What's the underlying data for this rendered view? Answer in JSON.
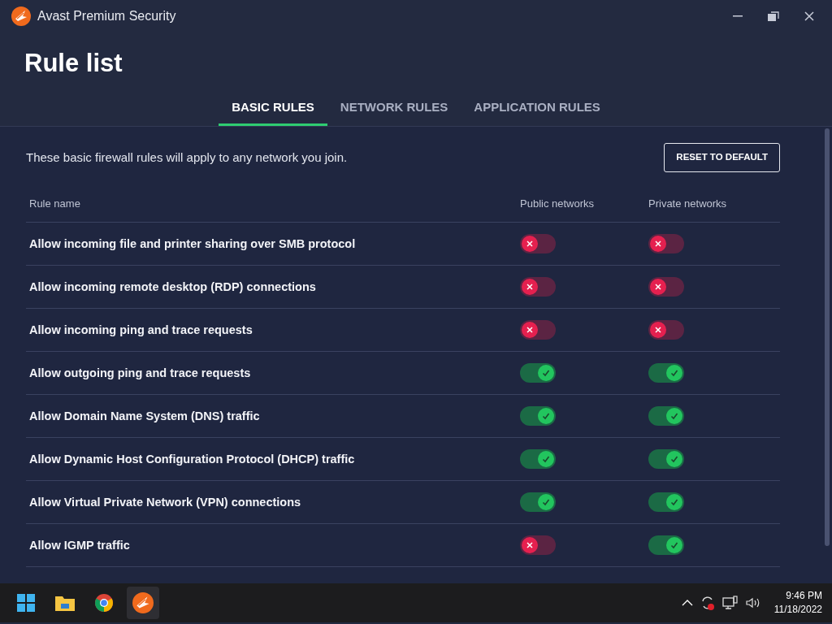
{
  "window": {
    "title": "Avast Premium Security"
  },
  "page_title": "Rule list",
  "tabs": [
    {
      "label": "BASIC RULES",
      "selected": true
    },
    {
      "label": "NETWORK RULES",
      "selected": false
    },
    {
      "label": "APPLICATION RULES",
      "selected": false
    }
  ],
  "description": "These basic firewall rules will apply to any network you join.",
  "reset_button": "RESET TO DEFAULT",
  "table": {
    "columns": [
      "Rule name",
      "Public networks",
      "Private networks"
    ],
    "rows": [
      {
        "name": "Allow incoming file and printer sharing over SMB protocol",
        "public_on": false,
        "private_on": false
      },
      {
        "name": "Allow incoming remote desktop (RDP) connections",
        "public_on": false,
        "private_on": false
      },
      {
        "name": "Allow incoming ping and trace requests",
        "public_on": false,
        "private_on": false
      },
      {
        "name": "Allow outgoing ping and trace requests",
        "public_on": true,
        "private_on": true
      },
      {
        "name": "Allow Domain Name System (DNS) traffic",
        "public_on": true,
        "private_on": true
      },
      {
        "name": "Allow Dynamic Host Configuration Protocol (DHCP) traffic",
        "public_on": true,
        "private_on": true
      },
      {
        "name": "Allow Virtual Private Network (VPN) connections",
        "public_on": true,
        "private_on": true
      },
      {
        "name": "Allow IGMP traffic",
        "public_on": false,
        "private_on": true
      }
    ]
  },
  "taskbar": {
    "time": "9:46 PM",
    "date": "11/18/2022"
  }
}
